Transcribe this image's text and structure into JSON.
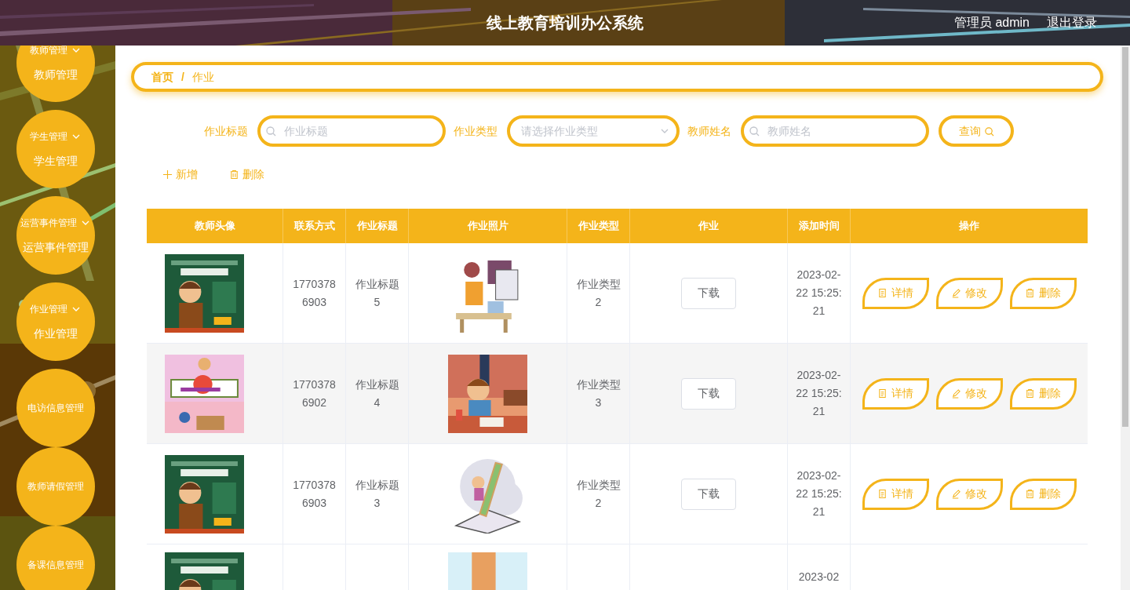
{
  "header": {
    "title": "线上教育培训办公系统",
    "user": "管理员 admin",
    "logout": "退出登录"
  },
  "sidebar": {
    "items": [
      {
        "label": "教师管理",
        "expanded": true,
        "children": [
          {
            "label": "教师管理"
          }
        ]
      },
      {
        "label": "学生管理",
        "expanded": true,
        "children": [
          {
            "label": "学生管理"
          }
        ]
      },
      {
        "label": "运营事件管理",
        "expanded": true,
        "children": [
          {
            "label": "运营事件管理"
          }
        ]
      },
      {
        "label": "作业管理",
        "expanded": true,
        "children": [
          {
            "label": "作业管理"
          }
        ]
      },
      {
        "label": "电访信息管理"
      },
      {
        "label": "教师请假管理"
      },
      {
        "label": "备课信息管理"
      }
    ]
  },
  "breadcrumb": {
    "items": [
      {
        "label": "首页"
      },
      {
        "label": "作业"
      }
    ],
    "separator": "/"
  },
  "filters": [
    {
      "kind": "text",
      "label": "作业标题",
      "placeholder": "作业标题"
    },
    {
      "kind": "select",
      "label": "作业类型",
      "placeholder": "请选择作业类型"
    },
    {
      "kind": "text",
      "label": "教师姓名",
      "placeholder": "教师姓名"
    }
  ],
  "search_button": "查询",
  "actions": [
    {
      "kind": "add",
      "label": "新增"
    },
    {
      "kind": "delete",
      "label": "删除"
    }
  ],
  "table": {
    "columns": [
      "教师头像",
      "联系方式",
      "作业标题",
      "作业照片",
      "作业类型",
      "作业",
      "添加时间",
      "操作"
    ],
    "rows": [
      {
        "phone": "17703786903",
        "title": "作业标题5",
        "type": "作业类型2",
        "download": "下载",
        "added": "2023-02-22 15:25:21",
        "buttons": [
          {
            "kind": "detail",
            "label": "详情"
          },
          {
            "kind": "edit",
            "label": "修改"
          },
          {
            "kind": "delete",
            "label": "删除"
          }
        ]
      },
      {
        "phone": "17703786902",
        "title": "作业标题4",
        "type": "作业类型3",
        "download": "下载",
        "added": "2023-02-22 15:25:21",
        "buttons": [
          {
            "kind": "detail",
            "label": "详情"
          },
          {
            "kind": "edit",
            "label": "修改"
          },
          {
            "kind": "delete",
            "label": "删除"
          }
        ]
      },
      {
        "phone": "17703786903",
        "title": "作业标题3",
        "type": "作业类型2",
        "download": "下载",
        "added": "2023-02-22 15:25:21",
        "buttons": [
          {
            "kind": "detail",
            "label": "详情"
          },
          {
            "kind": "edit",
            "label": "修改"
          },
          {
            "kind": "delete",
            "label": "删除"
          }
        ]
      },
      {
        "added": "2023-02"
      }
    ]
  }
}
